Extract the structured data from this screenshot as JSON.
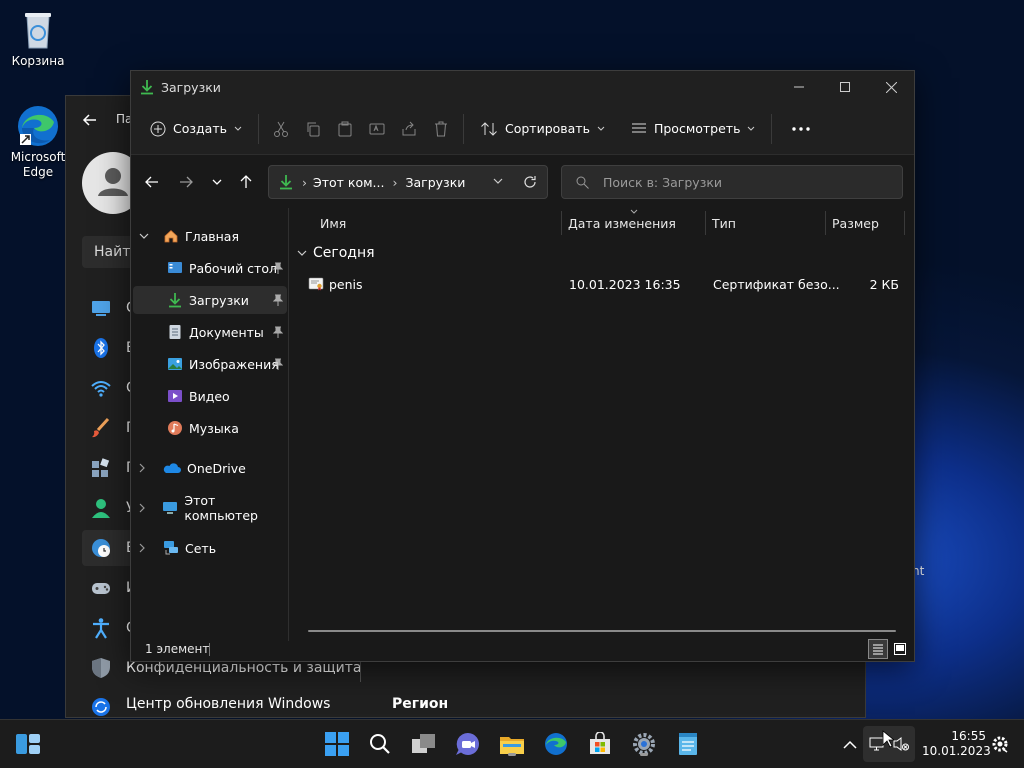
{
  "desktop": {
    "icons": [
      {
        "label": "Корзина",
        "icon": "recycle-bin-icon"
      },
      {
        "label": "Microsoft Edge",
        "icon": "edge-icon"
      }
    ]
  },
  "settings": {
    "title_partial": "Па",
    "search_placeholder_partial": "Найти",
    "nav": [
      {
        "label_partial": "С",
        "icon": "system-icon"
      },
      {
        "label_partial": "B",
        "icon": "bluetooth-icon"
      },
      {
        "label_partial": "С",
        "icon": "wifi-icon"
      },
      {
        "label_partial": "П",
        "icon": "brush-icon"
      },
      {
        "label_partial": "П",
        "icon": "apps-icon"
      },
      {
        "label_partial": "У",
        "icon": "accounts-icon"
      },
      {
        "label_partial": "В",
        "icon": "time-language-icon"
      },
      {
        "label_partial": "И",
        "icon": "gaming-icon"
      },
      {
        "label_partial": "С",
        "icon": "accessibility-icon"
      },
      {
        "label": "Конфиденциальность и защита",
        "icon": "shield-icon"
      },
      {
        "label": "Центр обновления Windows",
        "icon": "update-icon"
      }
    ],
    "region_heading": "Регион",
    "right_fragment": "nt"
  },
  "explorer": {
    "title": "Загрузки",
    "toolbar": {
      "new_label": "Создать",
      "sort_label": "Сортировать",
      "view_label": "Просмотреть",
      "more_label": "..."
    },
    "address": {
      "crumbs": [
        "Этот ком...",
        "Загрузки"
      ]
    },
    "search_placeholder": "Поиск в: Загрузки",
    "sidebar": {
      "home": "Главная",
      "quick": [
        {
          "label": "Рабочий стол",
          "icon": "desktop-folder-icon",
          "pinned": true
        },
        {
          "label": "Загрузки",
          "icon": "downloads-folder-icon",
          "pinned": true,
          "selected": true
        },
        {
          "label": "Документы",
          "icon": "documents-folder-icon",
          "pinned": true
        },
        {
          "label": "Изображения",
          "icon": "pictures-folder-icon",
          "pinned": true
        },
        {
          "label": "Видео",
          "icon": "videos-folder-icon",
          "pinned": false
        },
        {
          "label": "Музыка",
          "icon": "music-folder-icon",
          "pinned": false
        }
      ],
      "onedrive": "OneDrive",
      "this_pc": "Этот компьютер",
      "network": "Сеть"
    },
    "columns": {
      "name": "Имя",
      "date": "Дата изменения",
      "type": "Тип",
      "size": "Размер"
    },
    "group": "Сегодня",
    "files": [
      {
        "name": "penis",
        "date": "10.01.2023 16:35",
        "type": "Сертификат безо...",
        "size": "2 КБ",
        "icon": "certificate-icon"
      }
    ],
    "status": "1 элемент"
  },
  "taskbar": {
    "time": "16:55",
    "date": "10.01.2023",
    "apps": [
      "start-icon",
      "search-icon",
      "task-view-icon",
      "chat-icon",
      "file-explorer-icon",
      "edge-icon",
      "store-icon",
      "settings-icon",
      "notepad-icon"
    ]
  },
  "colors": {
    "accent_green": "#3fb950",
    "folder_yellow": "#f2c14e",
    "link_blue": "#4cc2ff"
  }
}
